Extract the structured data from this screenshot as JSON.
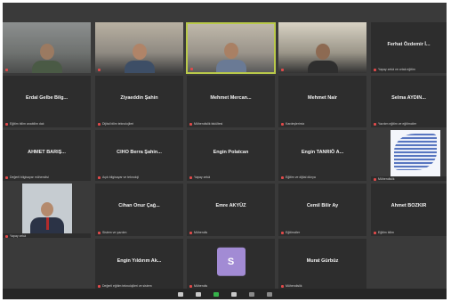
{
  "window": {
    "title": ""
  },
  "row1": [
    {
      "name": "",
      "sub": ""
    },
    {
      "name": "",
      "sub": ""
    },
    {
      "name": "",
      "sub": ""
    },
    {
      "name": "",
      "sub": ""
    },
    {
      "name": "Ferhat Özdemir İ...",
      "sub": "Yapay zekâ ve ortak eğitim"
    }
  ],
  "row2": [
    {
      "name": "Erdal Gelbe Bilg...",
      "sub": "Eğitim bilim anabilim dalı"
    },
    {
      "name": "Ziyaeddin Şahin",
      "sub": "Dijital bilim teknolojileri"
    },
    {
      "name": "Mehmet Mercan...",
      "sub": "Mühendislik fakültesi"
    },
    {
      "name": "Mehmet Nair",
      "sub": "Kardeşlerimiz"
    },
    {
      "name": "Selma AYDIN...",
      "sub": "Yazılım eğitim ve eğitimciler"
    }
  ],
  "row3": [
    {
      "name": "AHMET BARIŞ...",
      "sub": "Değerli bilgisayar mühendisi"
    },
    {
      "name": "CIHO Berra Şahin...",
      "sub": "Açık bilgisayar ve teknoloji"
    },
    {
      "name": "Engin Polatcan",
      "sub": "Yapay zekâ"
    },
    {
      "name": "Engin TANRIÖ A...",
      "sub": "Eğitim ve dijital dünya"
    },
    {
      "name": "",
      "sub": "Mühendislik"
    }
  ],
  "row4": [
    {
      "name": "",
      "sub": "Yapay zekâ"
    },
    {
      "name": "Cihan Onur Çağ...",
      "sub": "Sistem ve yazılım"
    },
    {
      "name": "Emre AKYÜZ",
      "sub": "Mühendis"
    },
    {
      "name": "Cemil Bilir Ay",
      "sub": "Eğitimciler"
    },
    {
      "name": "Ahmet BOZKIR",
      "sub": "Eğitim bilim"
    }
  ],
  "row5": [
    {
      "name": "Engin Yıldırım Ak...",
      "sub": "Değerli eğitim teknolojileri ve sistem"
    },
    {
      "name": "S",
      "sub": "Mühendis"
    },
    {
      "name": "Murat Gürbüz",
      "sub": "Mühendislik"
    }
  ],
  "toolbar": {
    "items": [
      "",
      "",
      "",
      "",
      "",
      ""
    ]
  },
  "colors": {
    "background": "#3a3a3a",
    "tile": "#2d2d2d",
    "active_border": "#b9c94a",
    "avatar": "#a28bd4",
    "mic_muted": "#e04a4a"
  }
}
